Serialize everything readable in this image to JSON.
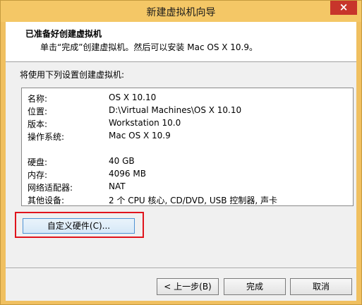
{
  "window": {
    "title": "新建虚拟机向导",
    "close_label": "×"
  },
  "header": {
    "title": "已准备好创建虚拟机",
    "subtitle": "单击“完成”创建虚拟机。然后可以安装 Mac OS X 10.9。"
  },
  "intro": "将使用下列设置创建虚拟机:",
  "settings": [
    {
      "key": "名称:",
      "value": "OS X 10.10"
    },
    {
      "key": "位置:",
      "value": "D:\\Virtual Machines\\OS X 10.10"
    },
    {
      "key": "版本:",
      "value": "Workstation 10.0"
    },
    {
      "key": "操作系统:",
      "value": "Mac OS X 10.9"
    },
    {
      "key": "硬盘:",
      "value": "40 GB"
    },
    {
      "key": "内存:",
      "value": "4096 MB"
    },
    {
      "key": "网络适配器:",
      "value": "NAT"
    },
    {
      "key": "其他设备:",
      "value": "2 个 CPU 核心, CD/DVD, USB 控制器, 声卡"
    }
  ],
  "buttons": {
    "customize": "自定义硬件(C)...",
    "back": "< 上一步(B)",
    "finish": "完成",
    "cancel": "取消"
  },
  "colors": {
    "highlight": "#e0141c",
    "title_bar": "#f4c766"
  }
}
